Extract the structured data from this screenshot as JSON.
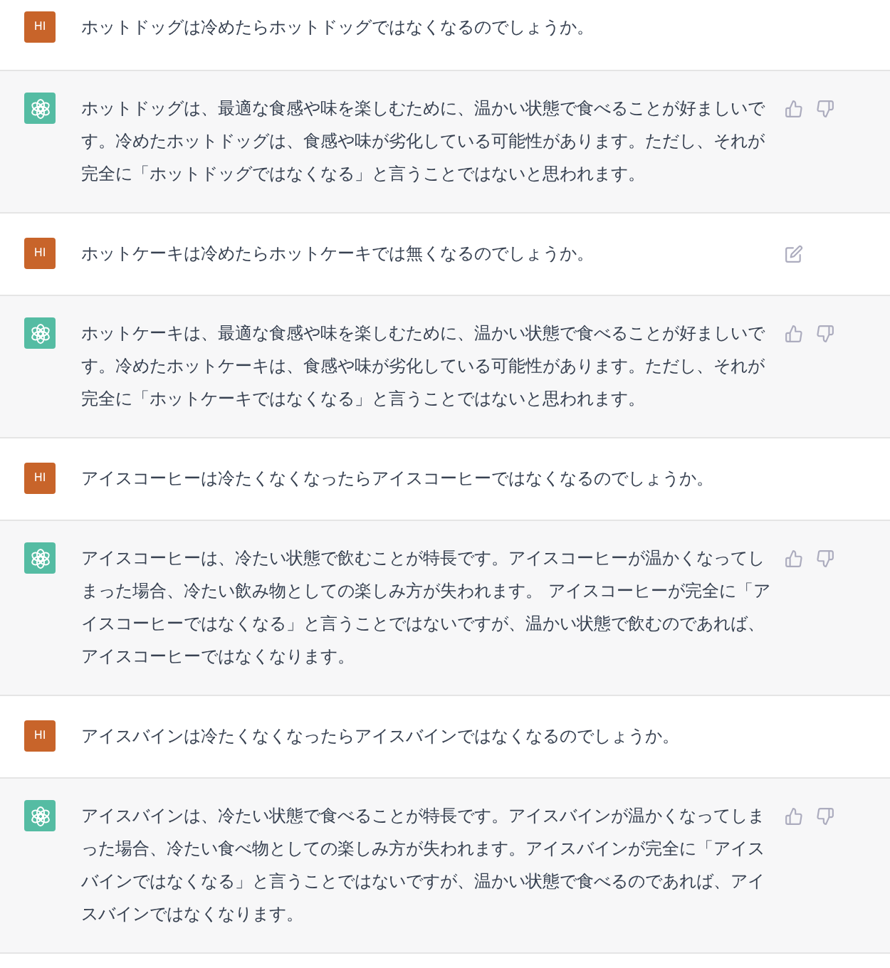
{
  "messages": [
    {
      "kind": "user",
      "avatar_text": "HI",
      "text": "ホットドッグは冷めたらホットドッグではなくなるのでしょうか。",
      "show_edit": false
    },
    {
      "kind": "assistant",
      "text": "ホットドッグは、最適な食感や味を楽しむために、温かい状態で食べることが好ましいです。冷めたホットドッグは、食感や味が劣化している可能性があります。ただし、それが完全に「ホットドッグではなくなる」と言うことではないと思われます。"
    },
    {
      "kind": "user",
      "avatar_text": "HI",
      "text": "ホットケーキは冷めたらホットケーキでは無くなるのでしょうか。",
      "show_edit": true
    },
    {
      "kind": "assistant",
      "text": "ホットケーキは、最適な食感や味を楽しむために、温かい状態で食べることが好ましいです。冷めたホットケーキは、食感や味が劣化している可能性があります。ただし、それが完全に「ホットケーキではなくなる」と言うことではないと思われます。"
    },
    {
      "kind": "user",
      "avatar_text": "HI",
      "text": "アイスコーヒーは冷たくなくなったらアイスコーヒーではなくなるのでしょうか。",
      "show_edit": false
    },
    {
      "kind": "assistant",
      "text": "アイスコーヒーは、冷たい状態で飲むことが特長です。アイスコーヒーが温かくなってしまった場合、冷たい飲み物としての楽しみ方が失われます。 アイスコーヒーが完全に「アイスコーヒーではなくなる」と言うことではないですが、温かい状態で飲むのであれば、アイスコーヒーではなくなります。"
    },
    {
      "kind": "user",
      "avatar_text": "HI",
      "text": "アイスバインは冷たくなくなったらアイスバインではなくなるのでしょうか。",
      "show_edit": false
    },
    {
      "kind": "assistant",
      "text": "アイスバインは、冷たい状態で食べることが特長です。アイスバインが温かくなってしまった場合、冷たい食べ物としての楽しみ方が失われます。アイスバインが完全に「アイスバインではなくなる」と言うことではないですが、温かい状態で食べるのであれば、アイスバインではなくなります。"
    }
  ]
}
